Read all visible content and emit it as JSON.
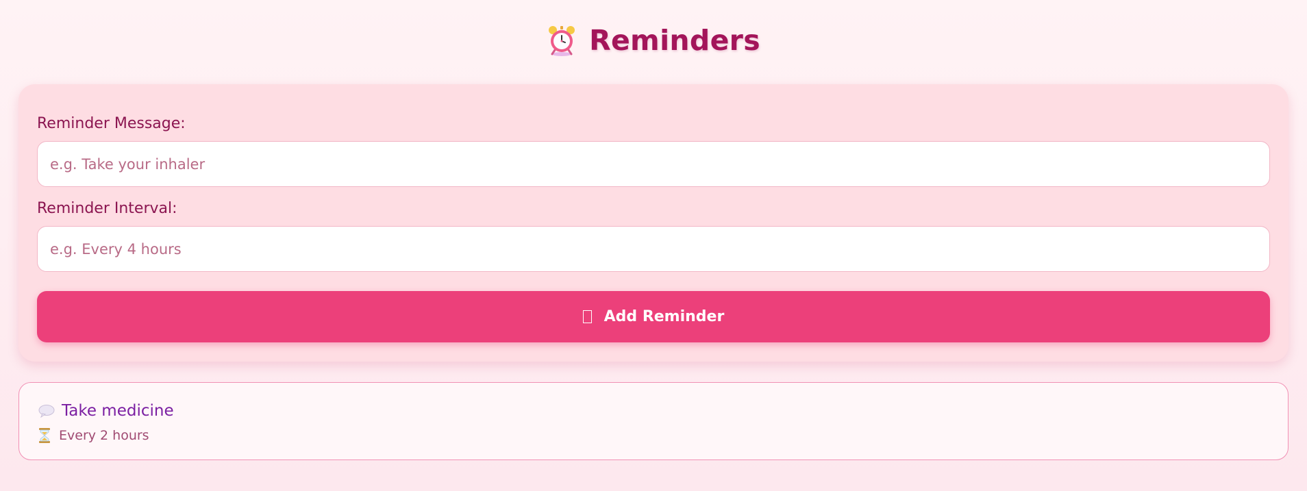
{
  "header": {
    "title": "Reminders",
    "icon": "alarm-clock-icon"
  },
  "form": {
    "message_label": "Reminder Message:",
    "message_placeholder": "e.g. Take your inhaler",
    "message_value": "",
    "interval_label": "Reminder Interval:",
    "interval_placeholder": "e.g. Every 4 hours",
    "interval_value": "",
    "add_button_label": "Add Reminder",
    "add_button_icon": "plus-icon"
  },
  "reminders": [
    {
      "message": "Take medicine",
      "message_icon": "speech-bubble-icon",
      "interval": "Every 2 hours",
      "interval_icon": "hourglass-icon"
    }
  ],
  "colors": {
    "title": "#a3155a",
    "card_background": "#fedde3",
    "button": "#ec407a",
    "label": "#8b1550",
    "reminder_message": "#7b1fa2",
    "reminder_border": "#f190b4"
  }
}
